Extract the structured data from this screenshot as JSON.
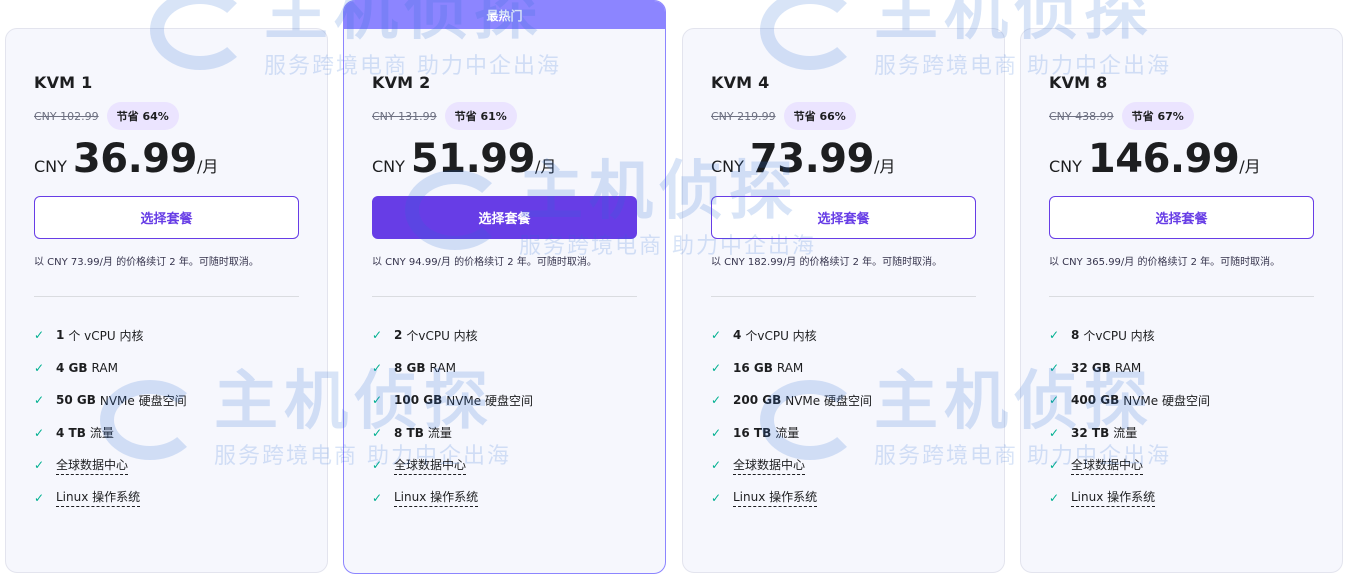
{
  "plans": [
    {
      "name": "KVM 1",
      "old_price": "CNY 102.99",
      "discount": "节省 64%",
      "currency": "CNY",
      "price": "36.99",
      "period": "/月",
      "button": "选择套餐",
      "renew": "以 CNY 73.99/月 的价格续订 2 年。可随时取消。",
      "features": [
        {
          "bold": "1",
          "text": "个 vCPU 内核"
        },
        {
          "bold": "4 GB",
          "text": "RAM"
        },
        {
          "bold": "50 GB",
          "text": "NVMe 硬盘空间"
        },
        {
          "bold": "4 TB",
          "text": "流量"
        },
        {
          "bold": "",
          "text": "全球数据中心"
        },
        {
          "bold": "",
          "text": "Linux 操作系统"
        }
      ]
    },
    {
      "name": "KVM 2",
      "ribbon": "最热门",
      "old_price": "CNY 131.99",
      "discount": "节省 61%",
      "currency": "CNY",
      "price": "51.99",
      "period": "/月",
      "button": "选择套餐",
      "renew": "以 CNY 94.99/月 的价格续订 2 年。可随时取消。",
      "features": [
        {
          "bold": "2",
          "text": "个vCPU 内核"
        },
        {
          "bold": "8 GB",
          "text": "RAM"
        },
        {
          "bold": "100 GB",
          "text": "NVMe 硬盘空间"
        },
        {
          "bold": "8 TB",
          "text": "流量"
        },
        {
          "bold": "",
          "text": "全球数据中心"
        },
        {
          "bold": "",
          "text": "Linux 操作系统"
        }
      ]
    },
    {
      "name": "KVM 4",
      "old_price": "CNY 219.99",
      "discount": "节省 66%",
      "currency": "CNY",
      "price": "73.99",
      "period": "/月",
      "button": "选择套餐",
      "renew": "以 CNY 182.99/月 的价格续订 2 年。可随时取消。",
      "features": [
        {
          "bold": "4",
          "text": "个vCPU 内核"
        },
        {
          "bold": "16 GB",
          "text": "RAM"
        },
        {
          "bold": "200 GB",
          "text": "NVMe 硬盘空间"
        },
        {
          "bold": "16 TB",
          "text": "流量"
        },
        {
          "bold": "",
          "text": "全球数据中心"
        },
        {
          "bold": "",
          "text": "Linux 操作系统"
        }
      ]
    },
    {
      "name": "KVM 8",
      "old_price": "CNY 438.99",
      "discount": "节省 67%",
      "currency": "CNY",
      "price": "146.99",
      "period": "/月",
      "button": "选择套餐",
      "renew": "以 CNY 365.99/月 的价格续订 2 年。可随时取消。",
      "features": [
        {
          "bold": "8",
          "text": "个vCPU 内核"
        },
        {
          "bold": "32 GB",
          "text": "RAM"
        },
        {
          "bold": "400 GB",
          "text": "NVMe 硬盘空间"
        },
        {
          "bold": "32 TB",
          "text": "流量"
        },
        {
          "bold": "",
          "text": "全球数据中心"
        },
        {
          "bold": "",
          "text": "Linux 操作系统"
        }
      ]
    }
  ],
  "watermark": {
    "title": "主机侦探",
    "subtitle": "服务跨境电商 助力中企出海"
  },
  "colors": {
    "accent": "#673de6",
    "ribbon": "#8c85ff",
    "discount_bg": "#ebe4ff",
    "check": "#00b090",
    "card_bg": "#f6f7fd"
  }
}
